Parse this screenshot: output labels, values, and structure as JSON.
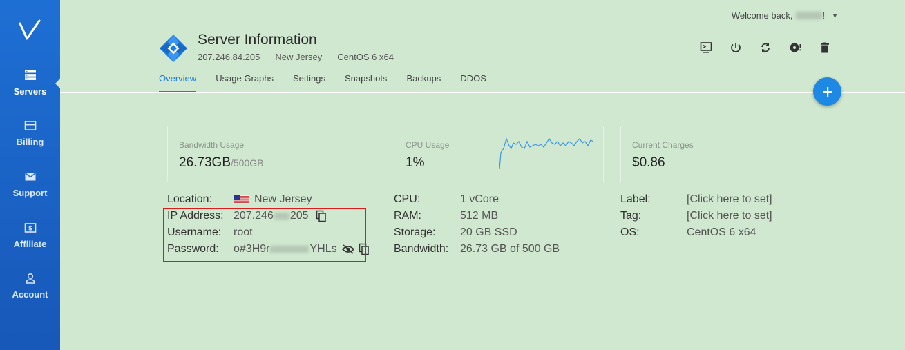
{
  "sidebar": {
    "logo": "V",
    "items": [
      {
        "label": "Servers",
        "icon": "servers-icon",
        "active": true
      },
      {
        "label": "Billing",
        "icon": "billing-icon"
      },
      {
        "label": "Support",
        "icon": "mail-icon"
      },
      {
        "label": "Affiliate",
        "icon": "affiliate-icon"
      },
      {
        "label": "Account",
        "icon": "user-icon"
      }
    ]
  },
  "header": {
    "welcome": "Welcome back,",
    "welcome_suffix": "!"
  },
  "server": {
    "title": "Server Information",
    "ip": "207.246.84.205",
    "location": "New Jersey",
    "os": "CentOS 6 x64"
  },
  "actions": [
    "console-icon",
    "power-icon",
    "restart-icon",
    "reinstall-icon",
    "delete-icon"
  ],
  "tabs": [
    "Overview",
    "Usage Graphs",
    "Settings",
    "Snapshots",
    "Backups",
    "DDOS"
  ],
  "cards": {
    "bandwidth": {
      "label": "Bandwidth Usage",
      "value": "26.73GB",
      "suffix": "/500GB"
    },
    "cpu": {
      "label": "CPU Usage",
      "value": "1%"
    },
    "charges": {
      "label": "Current Charges",
      "value": "$0.86"
    }
  },
  "details": {
    "col1": {
      "location_label": "Location:",
      "location_value": "New Jersey",
      "ip_label": "IP Address:",
      "ip_prefix": "207.246",
      "ip_suffix": "205",
      "username_label": "Username:",
      "username_value": "root",
      "password_label": "Password:",
      "password_prefix": "o#3H9r",
      "password_suffix": "YHLs"
    },
    "col2": {
      "cpu_label": "CPU:",
      "cpu_value": "1 vCore",
      "ram_label": "RAM:",
      "ram_value": "512 MB",
      "storage_label": "Storage:",
      "storage_value": "20 GB SSD",
      "bandwidth_label": "Bandwidth:",
      "bandwidth_value": "26.73 GB of 500 GB"
    },
    "col3": {
      "label_label": "Label:",
      "label_value": "[Click here to set]",
      "tag_label": "Tag:",
      "tag_value": "[Click here to set]",
      "os_label": "OS:",
      "os_value": "CentOS 6 x64"
    }
  },
  "colors": {
    "accent": "#1e7be0",
    "sidebar": "#1a63c8",
    "background": "#cfe8cf",
    "highlight": "#e01a1a"
  }
}
